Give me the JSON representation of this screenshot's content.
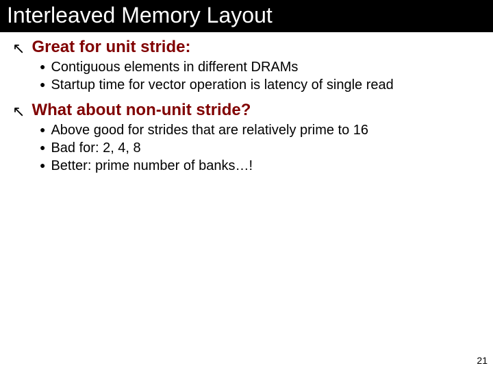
{
  "title": "Interleaved Memory Layout",
  "sections": [
    {
      "heading": "Great for unit stride:",
      "items": [
        "Contiguous elements in different DRAMs",
        "Startup time for vector operation is latency of single read"
      ]
    },
    {
      "heading": "What about non-unit stride?",
      "items": [
        "Above good for strides that are relatively prime to 16",
        "Bad for: 2, 4, 8",
        "Better: prime number of banks…!"
      ]
    }
  ],
  "page_number": "21"
}
